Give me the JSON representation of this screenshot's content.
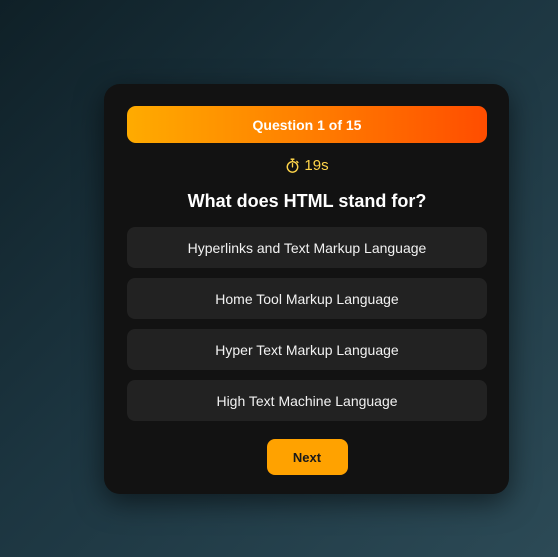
{
  "quiz": {
    "progress_label": "Question 1 of 15",
    "timer": {
      "icon": "stopwatch-icon",
      "value": "19s",
      "color": "#ffd54a"
    },
    "question": "What does HTML stand for?",
    "options": [
      "Hyperlinks and Text Markup Language",
      "Home Tool Markup Language",
      "Hyper Text Markup Language",
      "High Text Machine Language"
    ],
    "next_label": "Next"
  },
  "colors": {
    "banner_gradient": [
      "#ffab00",
      "#ff4d00"
    ],
    "card_background": "#121212",
    "option_background": "#222222",
    "next_button": "#ffa200"
  }
}
